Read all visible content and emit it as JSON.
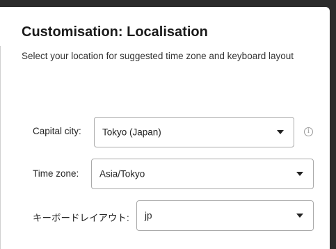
{
  "header": {
    "title": "Customisation: Localisation",
    "subtitle": "Select your location for suggested time zone and keyboard layout"
  },
  "form": {
    "capital_city": {
      "label": "Capital city:",
      "value": "Tokyo (Japan)"
    },
    "time_zone": {
      "label": "Time zone:",
      "value": "Asia/Tokyo"
    },
    "keyboard_layout": {
      "label": "キーボードレイアウト:",
      "value": "jp"
    }
  },
  "icons": {
    "info": "info-icon",
    "dropdown": "chevron-down-icon"
  },
  "colors": {
    "background": "#ffffff",
    "border": "#a9a9a9",
    "text": "#222222"
  }
}
